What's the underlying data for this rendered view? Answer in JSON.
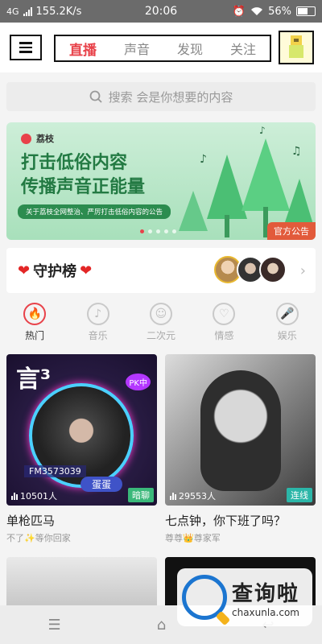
{
  "status": {
    "network": "4G",
    "speed": "155.2K/s",
    "time": "20:06",
    "battery": "56%"
  },
  "tabs": [
    {
      "label": "直播",
      "active": true
    },
    {
      "label": "声音",
      "active": false
    },
    {
      "label": "发现",
      "active": false
    },
    {
      "label": "关注",
      "active": false
    }
  ],
  "search": {
    "placeholder": "搜索 会是你想要的内容"
  },
  "banner": {
    "brand": "荔枝",
    "line1": "打击低俗内容",
    "line2": "传播声音正能量",
    "notice": "关于荔枝全网整治、严厉打击低俗内容的公告",
    "badge": "官方公告"
  },
  "guard": {
    "title": "守护榜"
  },
  "categories": [
    {
      "label": "热门",
      "icon": "flame-icon",
      "active": true
    },
    {
      "label": "音乐",
      "icon": "music-note-icon",
      "active": false
    },
    {
      "label": "二次元",
      "icon": "anime-face-icon",
      "active": false
    },
    {
      "label": "情感",
      "icon": "heart-icon",
      "active": false
    },
    {
      "label": "娱乐",
      "icon": "microphone-icon",
      "active": false
    }
  ],
  "cards": [
    {
      "count": "10501人",
      "tag": "暗聊",
      "name": "单枪匹马",
      "sub": "不了✨等你回家",
      "fm": "FM3573039",
      "nick": "蛋蛋",
      "pk": "PK中"
    },
    {
      "count": "29553人",
      "tag": "连线",
      "name": "七点钟，你下班了吗？",
      "sub": "尊尊👑尊家军"
    }
  ],
  "watermark": {
    "cn": "查询啦",
    "en": "chaxunla.com"
  },
  "colors": {
    "accent": "#e8424a",
    "banner_green": "#237a43",
    "official_orange": "#e25a3b"
  }
}
